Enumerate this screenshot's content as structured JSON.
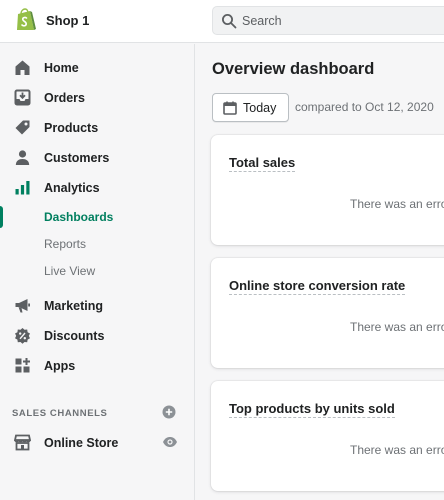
{
  "topbar": {
    "shop_name": "Shop 1",
    "search_placeholder": "Search"
  },
  "sidebar": {
    "items": [
      {
        "label": "Home",
        "icon": "home-icon"
      },
      {
        "label": "Orders",
        "icon": "orders-icon"
      },
      {
        "label": "Products",
        "icon": "tag-icon"
      },
      {
        "label": "Customers",
        "icon": "person-icon"
      },
      {
        "label": "Analytics",
        "icon": "bar-chart-icon"
      }
    ],
    "analytics_subitems": [
      {
        "label": "Dashboards",
        "active": true
      },
      {
        "label": "Reports",
        "active": false
      },
      {
        "label": "Live View",
        "active": false
      }
    ],
    "items_after": [
      {
        "label": "Marketing",
        "icon": "megaphone-icon"
      },
      {
        "label": "Discounts",
        "icon": "discount-icon"
      },
      {
        "label": "Apps",
        "icon": "apps-icon"
      }
    ],
    "sales_channels_heading": "SALES CHANNELS",
    "online_store_label": "Online Store"
  },
  "main": {
    "title": "Overview dashboard",
    "date_button_label": "Today",
    "compared_text": "compared to Oct 12, 2020",
    "cards": [
      {
        "title": "Total sales",
        "error": "There was an erro"
      },
      {
        "title": "Online store conversion rate",
        "error": "There was an erro"
      },
      {
        "title": "Top products by units sold",
        "error": "There was an erro"
      }
    ]
  },
  "colors": {
    "brand_green": "#008060",
    "logo_green": "#95bf47",
    "active_text": "#007f5f",
    "analytics_icon": "#008060"
  }
}
